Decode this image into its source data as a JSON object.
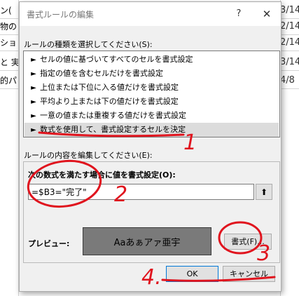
{
  "sheet": {
    "left_cells": [
      "ン(",
      "物の",
      "ショ",
      "と 実",
      "的パ"
    ],
    "right_cells": [
      "3/14",
      "2/14",
      "2/14",
      "3/14",
      "4/8"
    ]
  },
  "dialog": {
    "title": "書式ルールの編集",
    "help_glyph": "?",
    "close_glyph": "✕",
    "rule_type_label": "ルールの種類を選択してください(S):",
    "rule_types": [
      "セルの値に基づいてすべてのセルを書式設定",
      "指定の値を含むセルだけを書式設定",
      "上位または下位に入る値だけを書式設定",
      "平均より上または下の値だけを書式設定",
      "一意の値または重複する値だけを書式設定",
      "数式を使用して、書式設定するセルを決定"
    ],
    "rule_arrow": "►",
    "edit_label": "ルールの内容を編集してください(E):",
    "formula_label": "次の数式を満たす場合に値を書式設定(O):",
    "formula_value": "=$B3=\"完了\"",
    "ref_button_glyph": "⬆",
    "preview_label": "プレビュー:",
    "preview_text": "Aaあぁアァ亜宇",
    "format_button": "書式(F)...",
    "ok_button": "OK",
    "cancel_button": "キャンセル"
  },
  "annotations": {
    "numbers": [
      "1",
      "2",
      "3",
      "4."
    ],
    "color": "#e0141e"
  }
}
